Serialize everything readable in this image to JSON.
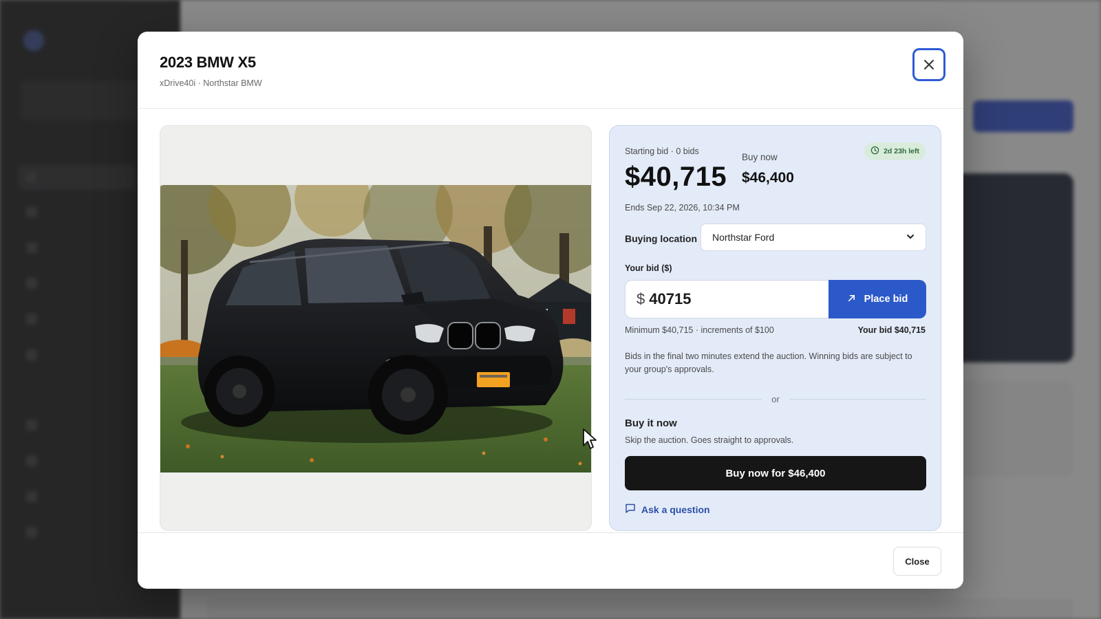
{
  "modal": {
    "title": "2023 BMW X5",
    "subtitle": "xDrive40i · Northstar BMW",
    "close_label": "Close"
  },
  "bid": {
    "starting_label": "Starting bid · 0 bids",
    "starting_price": "$40,715",
    "buy_now_label": "Buy now",
    "buy_now_price": "$46,400",
    "time_left": "2d 23h left",
    "ends": "Ends Sep 22, 2026, 10:34 PM",
    "location_label": "Buying location",
    "location_value": "Northstar Ford",
    "your_bid_label": "Your bid ($)",
    "currency_symbol": "$",
    "bid_value": "40715",
    "place_bid_label": "Place bid",
    "minimum_note": "Minimum $40,715 · increments of $100",
    "your_bid_note": "Your bid $40,715",
    "rules": "Bids in the final two minutes extend the auction. Winning bids are subject to your group's approvals.",
    "or": "or",
    "buy_it_now_title": "Buy it now",
    "buy_it_now_desc": "Skip the auction. Goes straight to approvals.",
    "buy_now_button": "Buy now for $46,400",
    "ask_question": "Ask a question"
  },
  "colors": {
    "accent": "#2c59c9",
    "panel": "#e3ebf8",
    "timer_bg": "#d9ecdc",
    "timer_text": "#2f6a3c",
    "dark_button": "#161616"
  },
  "icons": {
    "close": "close-icon",
    "clock": "clock-icon",
    "chevron": "chevron-down-icon",
    "place_bid": "arrow-up-right-icon",
    "ask": "chat-bubble-icon"
  }
}
